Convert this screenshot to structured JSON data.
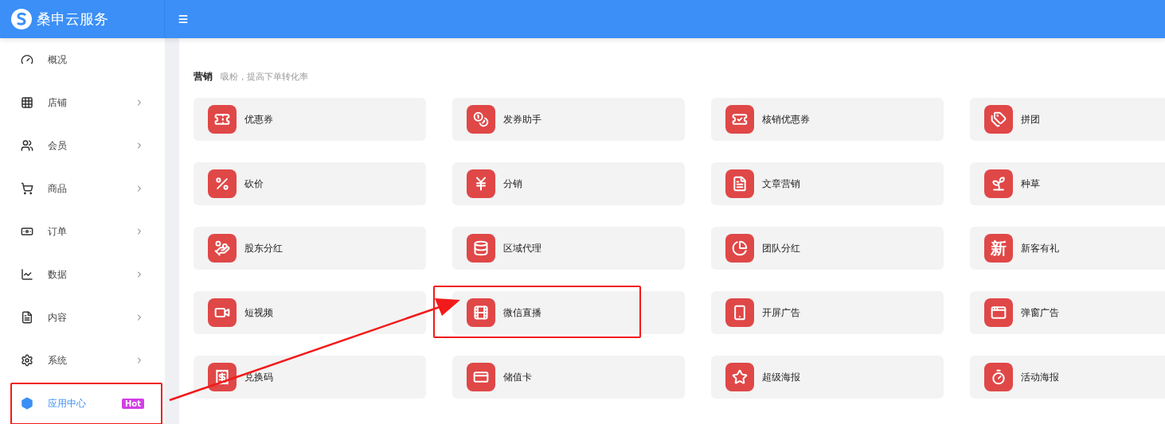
{
  "brand": {
    "title": "桑申云服务"
  },
  "sidebar": {
    "items": [
      {
        "label": "概况",
        "expandable": false,
        "selected": false,
        "highlighted": false
      },
      {
        "label": "店铺",
        "expandable": true,
        "selected": false,
        "highlighted": false
      },
      {
        "label": "会员",
        "expandable": true,
        "selected": false,
        "highlighted": false
      },
      {
        "label": "商品",
        "expandable": true,
        "selected": false,
        "highlighted": false
      },
      {
        "label": "订单",
        "expandable": true,
        "selected": false,
        "highlighted": false
      },
      {
        "label": "数据",
        "expandable": true,
        "selected": false,
        "highlighted": false
      },
      {
        "label": "内容",
        "expandable": true,
        "selected": false,
        "highlighted": false
      },
      {
        "label": "系统",
        "expandable": true,
        "selected": false,
        "highlighted": false
      },
      {
        "label": "应用中心",
        "expandable": false,
        "selected": true,
        "highlighted": true,
        "badge": "Hot"
      }
    ]
  },
  "section": {
    "title": "营销",
    "subtitle": "吸粉，提高下单转化率"
  },
  "apps": [
    {
      "label": "优惠券",
      "highlighted": false
    },
    {
      "label": "发券助手",
      "highlighted": false
    },
    {
      "label": "核销优惠券",
      "highlighted": false
    },
    {
      "label": "拼团",
      "highlighted": false
    },
    {
      "label": "砍价",
      "highlighted": false
    },
    {
      "label": "分销",
      "highlighted": false
    },
    {
      "label": "文章营销",
      "highlighted": false
    },
    {
      "label": "种草",
      "highlighted": false
    },
    {
      "label": "股东分红",
      "highlighted": false
    },
    {
      "label": "区域代理",
      "highlighted": false
    },
    {
      "label": "团队分红",
      "highlighted": false
    },
    {
      "label": "新客有礼",
      "highlighted": false,
      "icon_text": "新"
    },
    {
      "label": "短视频",
      "highlighted": false
    },
    {
      "label": "微信直播",
      "highlighted": true
    },
    {
      "label": "开屏广告",
      "highlighted": false
    },
    {
      "label": "弹窗广告",
      "highlighted": false
    },
    {
      "label": "兑换码",
      "highlighted": false
    },
    {
      "label": "储值卡",
      "highlighted": false
    },
    {
      "label": "超级海报",
      "highlighted": false
    },
    {
      "label": "活动海报",
      "highlighted": false
    }
  ]
}
